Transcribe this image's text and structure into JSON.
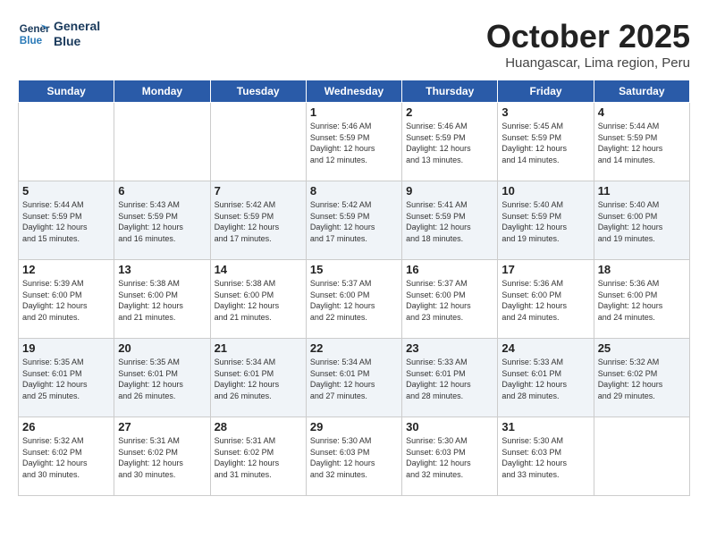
{
  "header": {
    "logo_line1": "General",
    "logo_line2": "Blue",
    "month": "October 2025",
    "location": "Huangascar, Lima region, Peru"
  },
  "days_of_week": [
    "Sunday",
    "Monday",
    "Tuesday",
    "Wednesday",
    "Thursday",
    "Friday",
    "Saturday"
  ],
  "weeks": [
    [
      {
        "day": "",
        "info": ""
      },
      {
        "day": "",
        "info": ""
      },
      {
        "day": "",
        "info": ""
      },
      {
        "day": "1",
        "info": "Sunrise: 5:46 AM\nSunset: 5:59 PM\nDaylight: 12 hours\nand 12 minutes."
      },
      {
        "day": "2",
        "info": "Sunrise: 5:46 AM\nSunset: 5:59 PM\nDaylight: 12 hours\nand 13 minutes."
      },
      {
        "day": "3",
        "info": "Sunrise: 5:45 AM\nSunset: 5:59 PM\nDaylight: 12 hours\nand 14 minutes."
      },
      {
        "day": "4",
        "info": "Sunrise: 5:44 AM\nSunset: 5:59 PM\nDaylight: 12 hours\nand 14 minutes."
      }
    ],
    [
      {
        "day": "5",
        "info": "Sunrise: 5:44 AM\nSunset: 5:59 PM\nDaylight: 12 hours\nand 15 minutes."
      },
      {
        "day": "6",
        "info": "Sunrise: 5:43 AM\nSunset: 5:59 PM\nDaylight: 12 hours\nand 16 minutes."
      },
      {
        "day": "7",
        "info": "Sunrise: 5:42 AM\nSunset: 5:59 PM\nDaylight: 12 hours\nand 17 minutes."
      },
      {
        "day": "8",
        "info": "Sunrise: 5:42 AM\nSunset: 5:59 PM\nDaylight: 12 hours\nand 17 minutes."
      },
      {
        "day": "9",
        "info": "Sunrise: 5:41 AM\nSunset: 5:59 PM\nDaylight: 12 hours\nand 18 minutes."
      },
      {
        "day": "10",
        "info": "Sunrise: 5:40 AM\nSunset: 5:59 PM\nDaylight: 12 hours\nand 19 minutes."
      },
      {
        "day": "11",
        "info": "Sunrise: 5:40 AM\nSunset: 6:00 PM\nDaylight: 12 hours\nand 19 minutes."
      }
    ],
    [
      {
        "day": "12",
        "info": "Sunrise: 5:39 AM\nSunset: 6:00 PM\nDaylight: 12 hours\nand 20 minutes."
      },
      {
        "day": "13",
        "info": "Sunrise: 5:38 AM\nSunset: 6:00 PM\nDaylight: 12 hours\nand 21 minutes."
      },
      {
        "day": "14",
        "info": "Sunrise: 5:38 AM\nSunset: 6:00 PM\nDaylight: 12 hours\nand 21 minutes."
      },
      {
        "day": "15",
        "info": "Sunrise: 5:37 AM\nSunset: 6:00 PM\nDaylight: 12 hours\nand 22 minutes."
      },
      {
        "day": "16",
        "info": "Sunrise: 5:37 AM\nSunset: 6:00 PM\nDaylight: 12 hours\nand 23 minutes."
      },
      {
        "day": "17",
        "info": "Sunrise: 5:36 AM\nSunset: 6:00 PM\nDaylight: 12 hours\nand 24 minutes."
      },
      {
        "day": "18",
        "info": "Sunrise: 5:36 AM\nSunset: 6:00 PM\nDaylight: 12 hours\nand 24 minutes."
      }
    ],
    [
      {
        "day": "19",
        "info": "Sunrise: 5:35 AM\nSunset: 6:01 PM\nDaylight: 12 hours\nand 25 minutes."
      },
      {
        "day": "20",
        "info": "Sunrise: 5:35 AM\nSunset: 6:01 PM\nDaylight: 12 hours\nand 26 minutes."
      },
      {
        "day": "21",
        "info": "Sunrise: 5:34 AM\nSunset: 6:01 PM\nDaylight: 12 hours\nand 26 minutes."
      },
      {
        "day": "22",
        "info": "Sunrise: 5:34 AM\nSunset: 6:01 PM\nDaylight: 12 hours\nand 27 minutes."
      },
      {
        "day": "23",
        "info": "Sunrise: 5:33 AM\nSunset: 6:01 PM\nDaylight: 12 hours\nand 28 minutes."
      },
      {
        "day": "24",
        "info": "Sunrise: 5:33 AM\nSunset: 6:01 PM\nDaylight: 12 hours\nand 28 minutes."
      },
      {
        "day": "25",
        "info": "Sunrise: 5:32 AM\nSunset: 6:02 PM\nDaylight: 12 hours\nand 29 minutes."
      }
    ],
    [
      {
        "day": "26",
        "info": "Sunrise: 5:32 AM\nSunset: 6:02 PM\nDaylight: 12 hours\nand 30 minutes."
      },
      {
        "day": "27",
        "info": "Sunrise: 5:31 AM\nSunset: 6:02 PM\nDaylight: 12 hours\nand 30 minutes."
      },
      {
        "day": "28",
        "info": "Sunrise: 5:31 AM\nSunset: 6:02 PM\nDaylight: 12 hours\nand 31 minutes."
      },
      {
        "day": "29",
        "info": "Sunrise: 5:30 AM\nSunset: 6:03 PM\nDaylight: 12 hours\nand 32 minutes."
      },
      {
        "day": "30",
        "info": "Sunrise: 5:30 AM\nSunset: 6:03 PM\nDaylight: 12 hours\nand 32 minutes."
      },
      {
        "day": "31",
        "info": "Sunrise: 5:30 AM\nSunset: 6:03 PM\nDaylight: 12 hours\nand 33 minutes."
      },
      {
        "day": "",
        "info": ""
      }
    ]
  ]
}
